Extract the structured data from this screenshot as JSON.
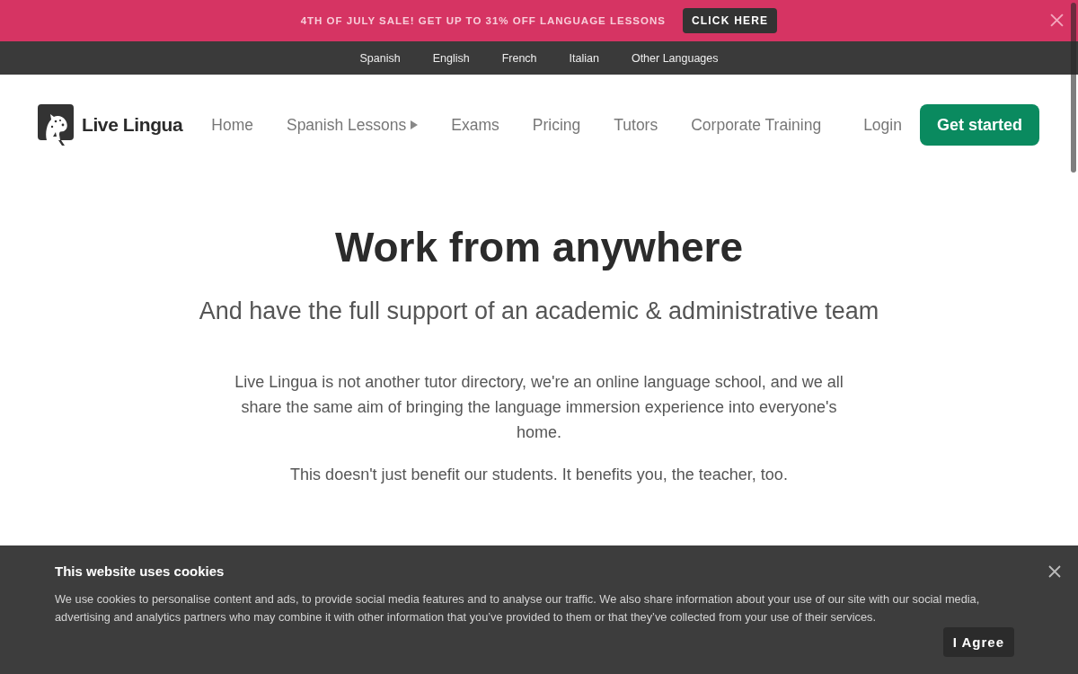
{
  "promo_bar": {
    "message": "4TH OF JULY SALE! GET UP TO 31% OFF LANGUAGE LESSONS",
    "button": "CLICK HERE"
  },
  "language_bar": {
    "items": [
      "Spanish",
      "English",
      "French",
      "Italian",
      "Other Languages"
    ]
  },
  "header": {
    "logo_text": "Live Lingua",
    "nav": [
      {
        "label": "Home",
        "kind": "link"
      },
      {
        "label": "Spanish Lessons",
        "kind": "dropdown"
      },
      {
        "label": "Exams",
        "kind": "link"
      },
      {
        "label": "Pricing",
        "kind": "link"
      },
      {
        "label": "Tutors",
        "kind": "link"
      },
      {
        "label": "Corporate Training",
        "kind": "link"
      }
    ],
    "login": "Login",
    "cta": "Get started"
  },
  "hero": {
    "title": "Work from anywhere",
    "subtitle": "And have the full support of an academic & administrative team",
    "paragraphs": [
      "Live Lingua is not another tutor directory, we're an online language school, and we all share the same aim of bringing the language immersion experience into everyone's home.",
      "This doesn't just benefit our students. It benefits you, the teacher, too."
    ]
  },
  "cookie_banner": {
    "title": "This website uses cookies",
    "text": "We use cookies to personalise content and ads, to provide social media features and to analyse our traffic. We also share information about your use of our site with our social media, advertising and analytics partners who may combine it with other information that you’ve provided to them or that they’ve collected from your use of their services.",
    "button": "I Agree"
  }
}
